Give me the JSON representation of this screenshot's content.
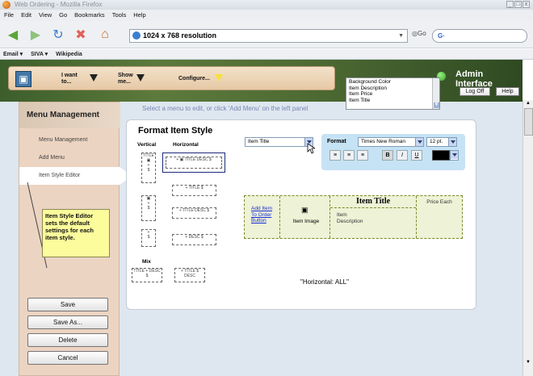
{
  "window": {
    "title": "Web Ordering - Mozilla Firefox"
  },
  "menubar": [
    "File",
    "Edit",
    "View",
    "Go",
    "Bookmarks",
    "Tools",
    "Help"
  ],
  "urlbar": {
    "value": "1024 x 768 resolution",
    "go": "Go",
    "search_prefix": "G·"
  },
  "bookmarks": [
    "Email ▾",
    "SIVA ▾",
    "Wikipedia"
  ],
  "topnav": {
    "i_want": "I want to...",
    "show_me": "Show me...",
    "configure": "Configure...",
    "dropdown_options": [
      "Background Color",
      "Item Description",
      "Item Price",
      "Item Title"
    ],
    "admin_title": "Admin Interface",
    "log_off": "Log Off",
    "help": "Help"
  },
  "sidebar": {
    "heading": "Menu Management",
    "items": [
      "Menu Management",
      "Add Menu",
      "Item Style Editor"
    ],
    "note": "Item Style Editor sets the default settings for each item style.",
    "buttons": [
      "Save",
      "Save As...",
      "Delete",
      "Cancel"
    ]
  },
  "main": {
    "select_message": "Select a menu to edit, or click 'Add Menu' on the left panel",
    "format_title": "Format Item Style",
    "vertical_label": "Vertical",
    "horizontal_label": "Horizontal",
    "mix_label": "Mix",
    "item_select": "Item Title",
    "format_label": "Format",
    "font": "Times New Roman",
    "font_size": "12 pt.",
    "style_buttons": [
      "B",
      "I",
      "U"
    ],
    "preview": {
      "add_item": "Add Item To Order Button",
      "item_image": "Item Image",
      "item_title": "Item Title",
      "item_description": "Item Description",
      "price_each": "Price Each"
    },
    "layout_caption": "\"Horizontal: ALL\""
  },
  "colors": {
    "accent": "#3c5e2b",
    "note": "#fcfc9c",
    "sidebar": "#ecd4c2",
    "format_panel": "#c6e2f5"
  }
}
